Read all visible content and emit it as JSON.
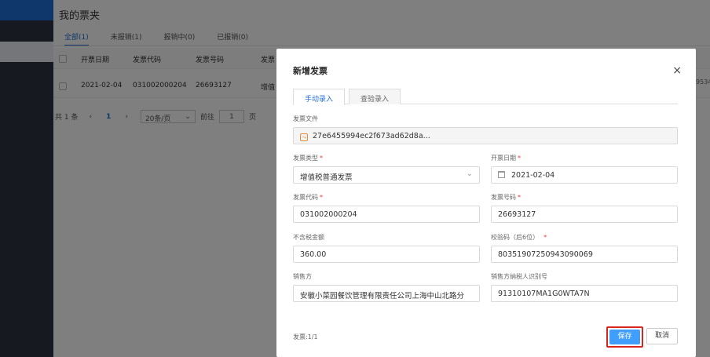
{
  "page": {
    "title": "我的票夹",
    "tabs": [
      "全部(1)",
      "未报销(1)",
      "报销中(0)",
      "已报销(0)"
    ],
    "columns": [
      "开票日期",
      "发票代码",
      "发票号码",
      "发票"
    ],
    "row": {
      "date": "2021-02-04",
      "code": "031002000204",
      "number": "26693127",
      "type_stub": "增值",
      "right_stub": "9534"
    },
    "pager": {
      "total": "共 1 条",
      "prev": "‹",
      "current": "1",
      "next": "›",
      "page_size": "20条/页",
      "goto_label": "前往",
      "goto_value": "1",
      "page_unit": "页"
    }
  },
  "modal": {
    "title": "新增发票",
    "close": "×",
    "tabs": [
      "手动录入",
      "查验录入"
    ],
    "fields": {
      "file_label": "发票文件",
      "file_value": "27e6455994ec2f673ad62d8a...",
      "type_label": "发票类型",
      "type_value": "增值税普通发票",
      "date_label": "开票日期",
      "date_value": "2021-02-04",
      "code_label": "发票代码",
      "code_value": "031002000204",
      "number_label": "发票号码",
      "number_value": "26693127",
      "amount_label": "不含税金额",
      "amount_value": "360.00",
      "check_label": "校验码（后6位）",
      "check_value": "80351907250943090069",
      "seller_label": "销售方",
      "seller_value": "安徽小菜园餐饮管理有限责任公司上海中山北路分",
      "taxid_label": "销售方纳税人识别号",
      "taxid_value": "91310107MA1G0WTA7N",
      "required_mark": "*"
    },
    "footer": {
      "count": "发票:1/1",
      "save": "保存",
      "cancel": "取消"
    }
  }
}
